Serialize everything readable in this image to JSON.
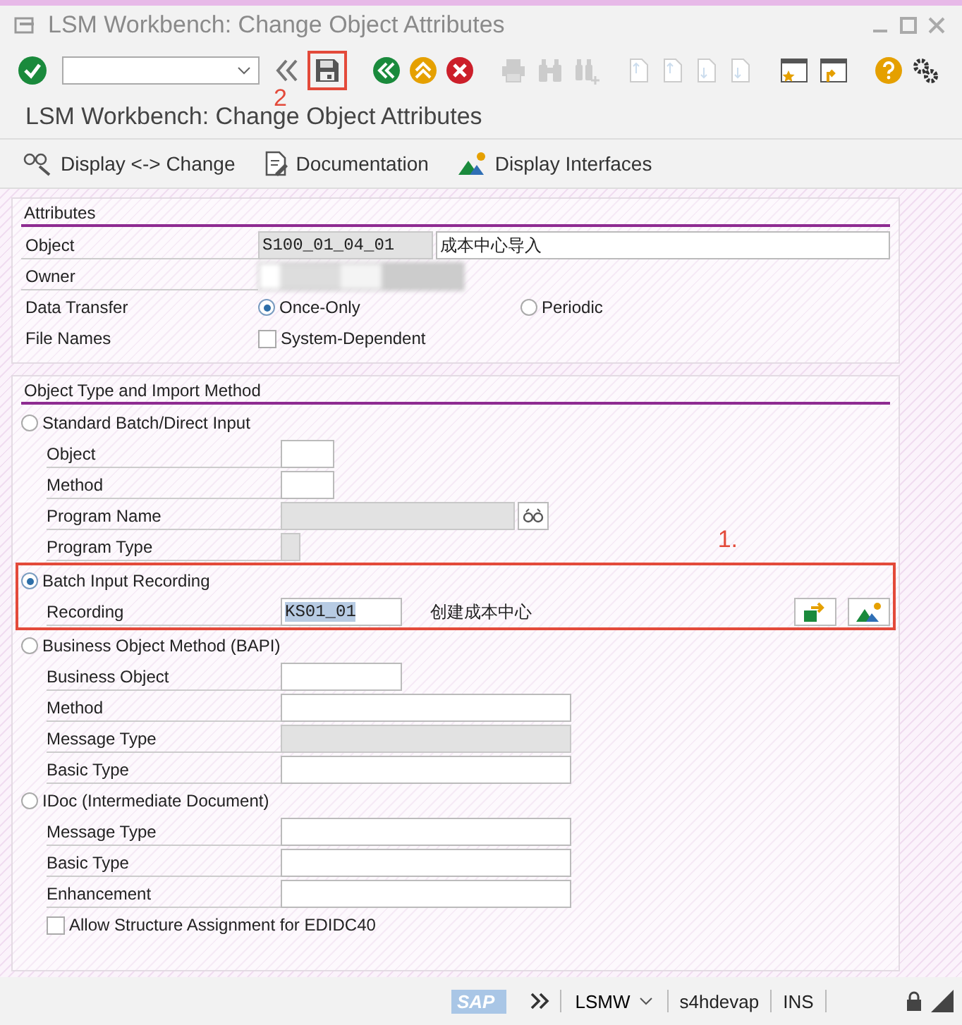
{
  "window": {
    "title": "LSM Workbench: Change Object Attributes"
  },
  "annotations": [
    {
      "label": "2"
    },
    {
      "label": "1."
    }
  ],
  "screen_title": "LSM Workbench: Change Object Attributes",
  "app_toolbar": [
    {
      "kind": "toggle",
      "label": "Display <-> Change"
    },
    {
      "kind": "docs",
      "label": "Documentation"
    },
    {
      "kind": "interfaces",
      "label": "Display Interfaces"
    }
  ],
  "attributes": {
    "title": "Attributes",
    "object": {
      "label": "Object",
      "value": "S100_01_04_01",
      "description": "成本中心导入"
    },
    "owner": {
      "label": "Owner"
    },
    "data_transfer": {
      "label": "Data Transfer",
      "options": [
        {
          "label": "Once-Only",
          "selected": true
        },
        {
          "label": "Periodic",
          "selected": false
        }
      ]
    },
    "file_names": {
      "label": "File Names",
      "checkbox": {
        "label": "System-Dependent",
        "checked": false
      }
    }
  },
  "import_method": {
    "title": "Object Type and Import Method",
    "methods": [
      {
        "label": "Standard Batch/Direct Input",
        "selected": false,
        "highlighted": false,
        "fields": [
          {
            "label": "Object",
            "kind": "short",
            "disabled": false
          },
          {
            "label": "Method",
            "kind": "short",
            "disabled": false
          },
          {
            "label": "Program Name",
            "kind": "wide",
            "disabled": true,
            "value_help": true
          },
          {
            "label": "Program Type",
            "kind": "tiny",
            "disabled": true
          }
        ]
      },
      {
        "label": "Batch Input Recording",
        "selected": true,
        "highlighted": true,
        "fields": [
          {
            "label": "Recording",
            "kind": "medium",
            "disabled": false,
            "value": "KS01_01",
            "text_selected": true,
            "description": "创建成本中心",
            "actions": [
              {
                "kind": "transfer"
              },
              {
                "kind": "interfaces"
              }
            ]
          }
        ]
      },
      {
        "label": "Business Object Method  (BAPI)",
        "selected": false,
        "highlighted": false,
        "fields": [
          {
            "label": "Business Object",
            "kind": "medium",
            "disabled": false
          },
          {
            "label": "Method",
            "kind": "long",
            "disabled": false
          },
          {
            "label": "Message Type",
            "kind": "long",
            "disabled": true
          },
          {
            "label": "Basic Type",
            "kind": "long",
            "disabled": false
          }
        ]
      },
      {
        "label": "IDoc (Intermediate Document)",
        "selected": false,
        "highlighted": false,
        "fields": [
          {
            "label": "Message Type",
            "kind": "long",
            "disabled": false
          },
          {
            "label": "Basic Type",
            "kind": "long",
            "disabled": false
          },
          {
            "label": "Enhancement",
            "kind": "long",
            "disabled": false
          }
        ],
        "checkbox": {
          "label": "Allow Structure Assignment for EDIDC40",
          "checked": false
        }
      }
    ]
  },
  "status_bar": {
    "logo": "SAP",
    "transaction": "LSMW",
    "system": "s4hdevap",
    "mode": "INS"
  }
}
